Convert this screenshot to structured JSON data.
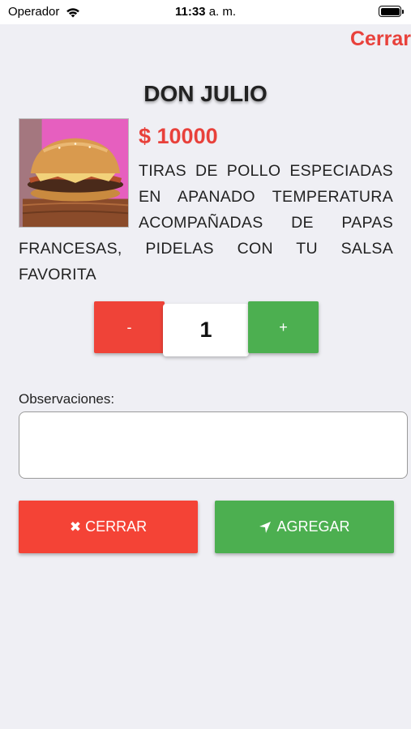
{
  "status_bar": {
    "carrier": "Operador",
    "time": "11:33",
    "ampm": "a. m."
  },
  "header": {
    "close_label": "Cerrar"
  },
  "product": {
    "name": "DON JULIO",
    "price": "$ 10000",
    "description": "TIRAS DE POLLO ESPECIADAS EN APANADO TEMPERATURA ACOMPAÑADAS DE PAPAS FRANCESAS, PIDELAS CON TU SALSA FAVORITA",
    "image": "burger-photo"
  },
  "quantity": {
    "minus_label": "-",
    "value": "1",
    "plus_label": "+"
  },
  "observations": {
    "label": "Observaciones:",
    "value": "",
    "placeholder": ""
  },
  "actions": {
    "close_label": "CERRAR",
    "close_icon": "times-icon",
    "add_label": "AGREGAR",
    "add_icon": "location-arrow-icon"
  },
  "colors": {
    "accent_red": "#f44336",
    "accent_green": "#4caf50",
    "background": "#efeff4"
  }
}
